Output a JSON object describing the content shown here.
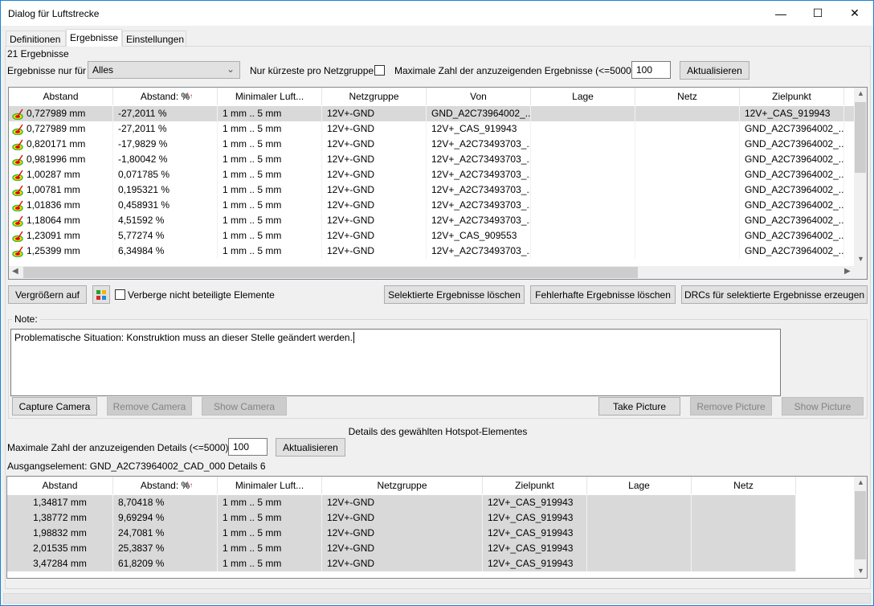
{
  "window": {
    "title": "Dialog für Luftstrecke",
    "minimize": "—",
    "maximize": "☐",
    "close": "✕"
  },
  "tabs": [
    {
      "label": "Definitionen"
    },
    {
      "label": "Ergebnisse",
      "active": true
    },
    {
      "label": "Einstellungen"
    }
  ],
  "results": {
    "count_label": "21 Ergebnisse",
    "filter_label": "Ergebnisse nur für",
    "filter_value": "Alles",
    "shortest_label": "Nur kürzeste pro Netzgruppe",
    "shortest_checked": false,
    "max_label": "Maximale Zahl der anzuzeigenden Ergebnisse (<=5000)",
    "max_value": "100",
    "refresh": "Aktualisieren",
    "columns": [
      "Abstand",
      "Abstand: %",
      "Minimaler Luft...",
      "Netzgruppe",
      "Von",
      "Lage",
      "Netz",
      "Zielpunkt"
    ],
    "rows": [
      [
        "0,727989 mm",
        "-27,2011 %",
        "1 mm .. 5 mm",
        "12V+-GND",
        "GND_A2C73964002_...",
        "",
        "",
        "12V+_CAS_919943"
      ],
      [
        "0,727989 mm",
        "-27,2011 %",
        "1 mm .. 5 mm",
        "12V+-GND",
        "12V+_CAS_919943",
        "",
        "",
        "GND_A2C73964002_..."
      ],
      [
        "0,820171 mm",
        "-17,9829 %",
        "1 mm .. 5 mm",
        "12V+-GND",
        "12V+_A2C73493703_...",
        "",
        "",
        "GND_A2C73964002_..."
      ],
      [
        "0,981996 mm",
        "-1,80042 %",
        "1 mm .. 5 mm",
        "12V+-GND",
        "12V+_A2C73493703_...",
        "",
        "",
        "GND_A2C73964002_..."
      ],
      [
        "1,00287 mm",
        "0,071785 %",
        "1 mm .. 5 mm",
        "12V+-GND",
        "12V+_A2C73493703_...",
        "",
        "",
        "GND_A2C73964002_..."
      ],
      [
        "1,00781 mm",
        "0,195321 %",
        "1 mm .. 5 mm",
        "12V+-GND",
        "12V+_A2C73493703_...",
        "",
        "",
        "GND_A2C73964002_..."
      ],
      [
        "1,01836 mm",
        "0,458931 %",
        "1 mm .. 5 mm",
        "12V+-GND",
        "12V+_A2C73493703_...",
        "",
        "",
        "GND_A2C73964002_..."
      ],
      [
        "1,18064 mm",
        "4,51592 %",
        "1 mm .. 5 mm",
        "12V+-GND",
        "12V+_A2C73493703_...",
        "",
        "",
        "GND_A2C73964002_..."
      ],
      [
        "1,23091 mm",
        "5,77274 %",
        "1 mm .. 5 mm",
        "12V+-GND",
        "12V+_CAS_909553",
        "",
        "",
        "GND_A2C73964002_..."
      ],
      [
        "1,25399 mm",
        "6,34984 %",
        "1 mm .. 5 mm",
        "12V+-GND",
        "12V+_A2C73493703_...",
        "",
        "",
        "GND_A2C73964002_..."
      ]
    ]
  },
  "actions": {
    "zoom": "Vergrößern auf",
    "hide_label": "Verberge nicht beteiligte Elemente",
    "delete_selected": "Selektierte Ergebnisse löschen",
    "delete_faulty": "Fehlerhafte Ergebnisse löschen",
    "create_drcs": "DRCs für selektierte Ergebnisse erzeugen"
  },
  "note": {
    "label": "Note:",
    "text": "Problematische Situation: Konstruktion muss an dieser Stelle geändert werden.",
    "capture_camera": "Capture Camera",
    "remove_camera": "Remove Camera",
    "show_camera": "Show Camera",
    "take_picture": "Take Picture",
    "remove_picture": "Remove Picture",
    "show_picture": "Show Picture"
  },
  "details": {
    "title": "Details des gewählten Hotspot-Elementes",
    "max_label": "Maximale Zahl der anzuzeigenden Details (<=5000)",
    "max_value": "100",
    "refresh": "Aktualisieren",
    "source_label": "Ausgangselement: GND_A2C73964002_CAD_000 Details 6",
    "columns": [
      "Abstand",
      "Abstand: %",
      "Minimaler Luft...",
      "Netzgruppe",
      "Zielpunkt",
      "Lage",
      "Netz"
    ],
    "rows": [
      [
        "1,34817 mm",
        "8,70418 %",
        "1 mm .. 5 mm",
        "12V+-GND",
        "12V+_CAS_919943",
        "",
        ""
      ],
      [
        "1,38772 mm",
        "9,69294 %",
        "1 mm .. 5 mm",
        "12V+-GND",
        "12V+_CAS_919943",
        "",
        ""
      ],
      [
        "1,98832 mm",
        "24,7081 %",
        "1 mm .. 5 mm",
        "12V+-GND",
        "12V+_CAS_919943",
        "",
        ""
      ],
      [
        "2,01535 mm",
        "25,3837 %",
        "1 mm .. 5 mm",
        "12V+-GND",
        "12V+_CAS_919943",
        "",
        ""
      ],
      [
        "3,47284 mm",
        "61,8209 %",
        "1 mm .. 5 mm",
        "12V+-GND",
        "12V+_CAS_919943",
        "",
        ""
      ]
    ]
  }
}
